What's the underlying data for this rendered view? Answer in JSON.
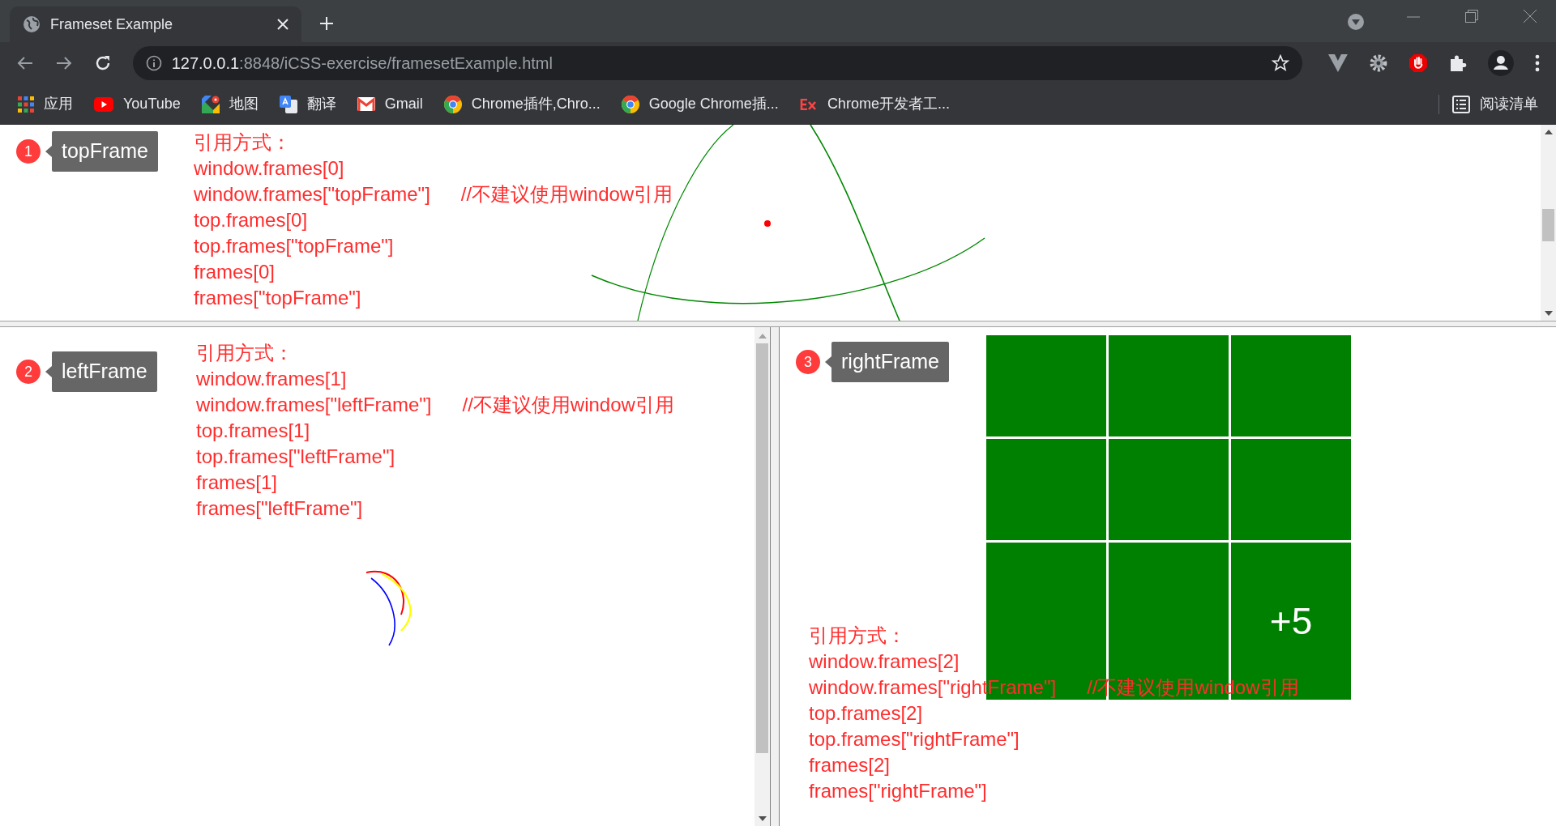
{
  "tab": {
    "title": "Frameset Example"
  },
  "address": {
    "host": "127.0.0.1",
    "path": ":8848/iCSS-exercise/framesetExample.html"
  },
  "bookmarks": [
    {
      "kind": "apps",
      "label": "应用"
    },
    {
      "kind": "youtube",
      "label": "YouTube"
    },
    {
      "kind": "maps",
      "label": "地图"
    },
    {
      "kind": "translate",
      "label": "翻译"
    },
    {
      "kind": "gmail",
      "label": "Gmail"
    },
    {
      "kind": "chrome",
      "label": "Chrome插件,Chro..."
    },
    {
      "kind": "chrome",
      "label": "Google Chrome插..."
    },
    {
      "kind": "ex",
      "label": "Chrome开发者工..."
    }
  ],
  "reading_list": "阅读清单",
  "frames": [
    {
      "number": "1",
      "label": "topFrame",
      "heading": "引用方式：",
      "lines": [
        {
          "code": "window.frames[0]"
        },
        {
          "code": "window.frames[\"topFrame\"]",
          "comment": "//不建议使用window引用"
        },
        {
          "code": "top.frames[0]"
        },
        {
          "code": "top.frames[\"topFrame\"]"
        },
        {
          "code": "frames[0]"
        },
        {
          "code": "frames[\"topFrame\"]"
        }
      ]
    },
    {
      "number": "2",
      "label": "leftFrame",
      "heading": "引用方式：",
      "lines": [
        {
          "code": "window.frames[1]"
        },
        {
          "code": "window.frames[\"leftFrame\"]",
          "comment": "//不建议使用window引用"
        },
        {
          "code": "top.frames[1]"
        },
        {
          "code": "top.frames[\"leftFrame\"]"
        },
        {
          "code": "frames[1]"
        },
        {
          "code": "frames[\"leftFrame\"]"
        }
      ]
    },
    {
      "number": "3",
      "label": "rightFrame",
      "heading": "引用方式：",
      "lines": [
        {
          "code": "window.frames[2]"
        },
        {
          "code": "window.frames[\"rightFrame\"]",
          "comment": "//不建议使用window引用"
        },
        {
          "code": "top.frames[2]"
        },
        {
          "code": "top.frames[\"rightFrame\"]"
        },
        {
          "code": "frames[2]"
        },
        {
          "code": "frames[\"rightFrame\"]"
        }
      ]
    }
  ],
  "grid_badge": "+5"
}
